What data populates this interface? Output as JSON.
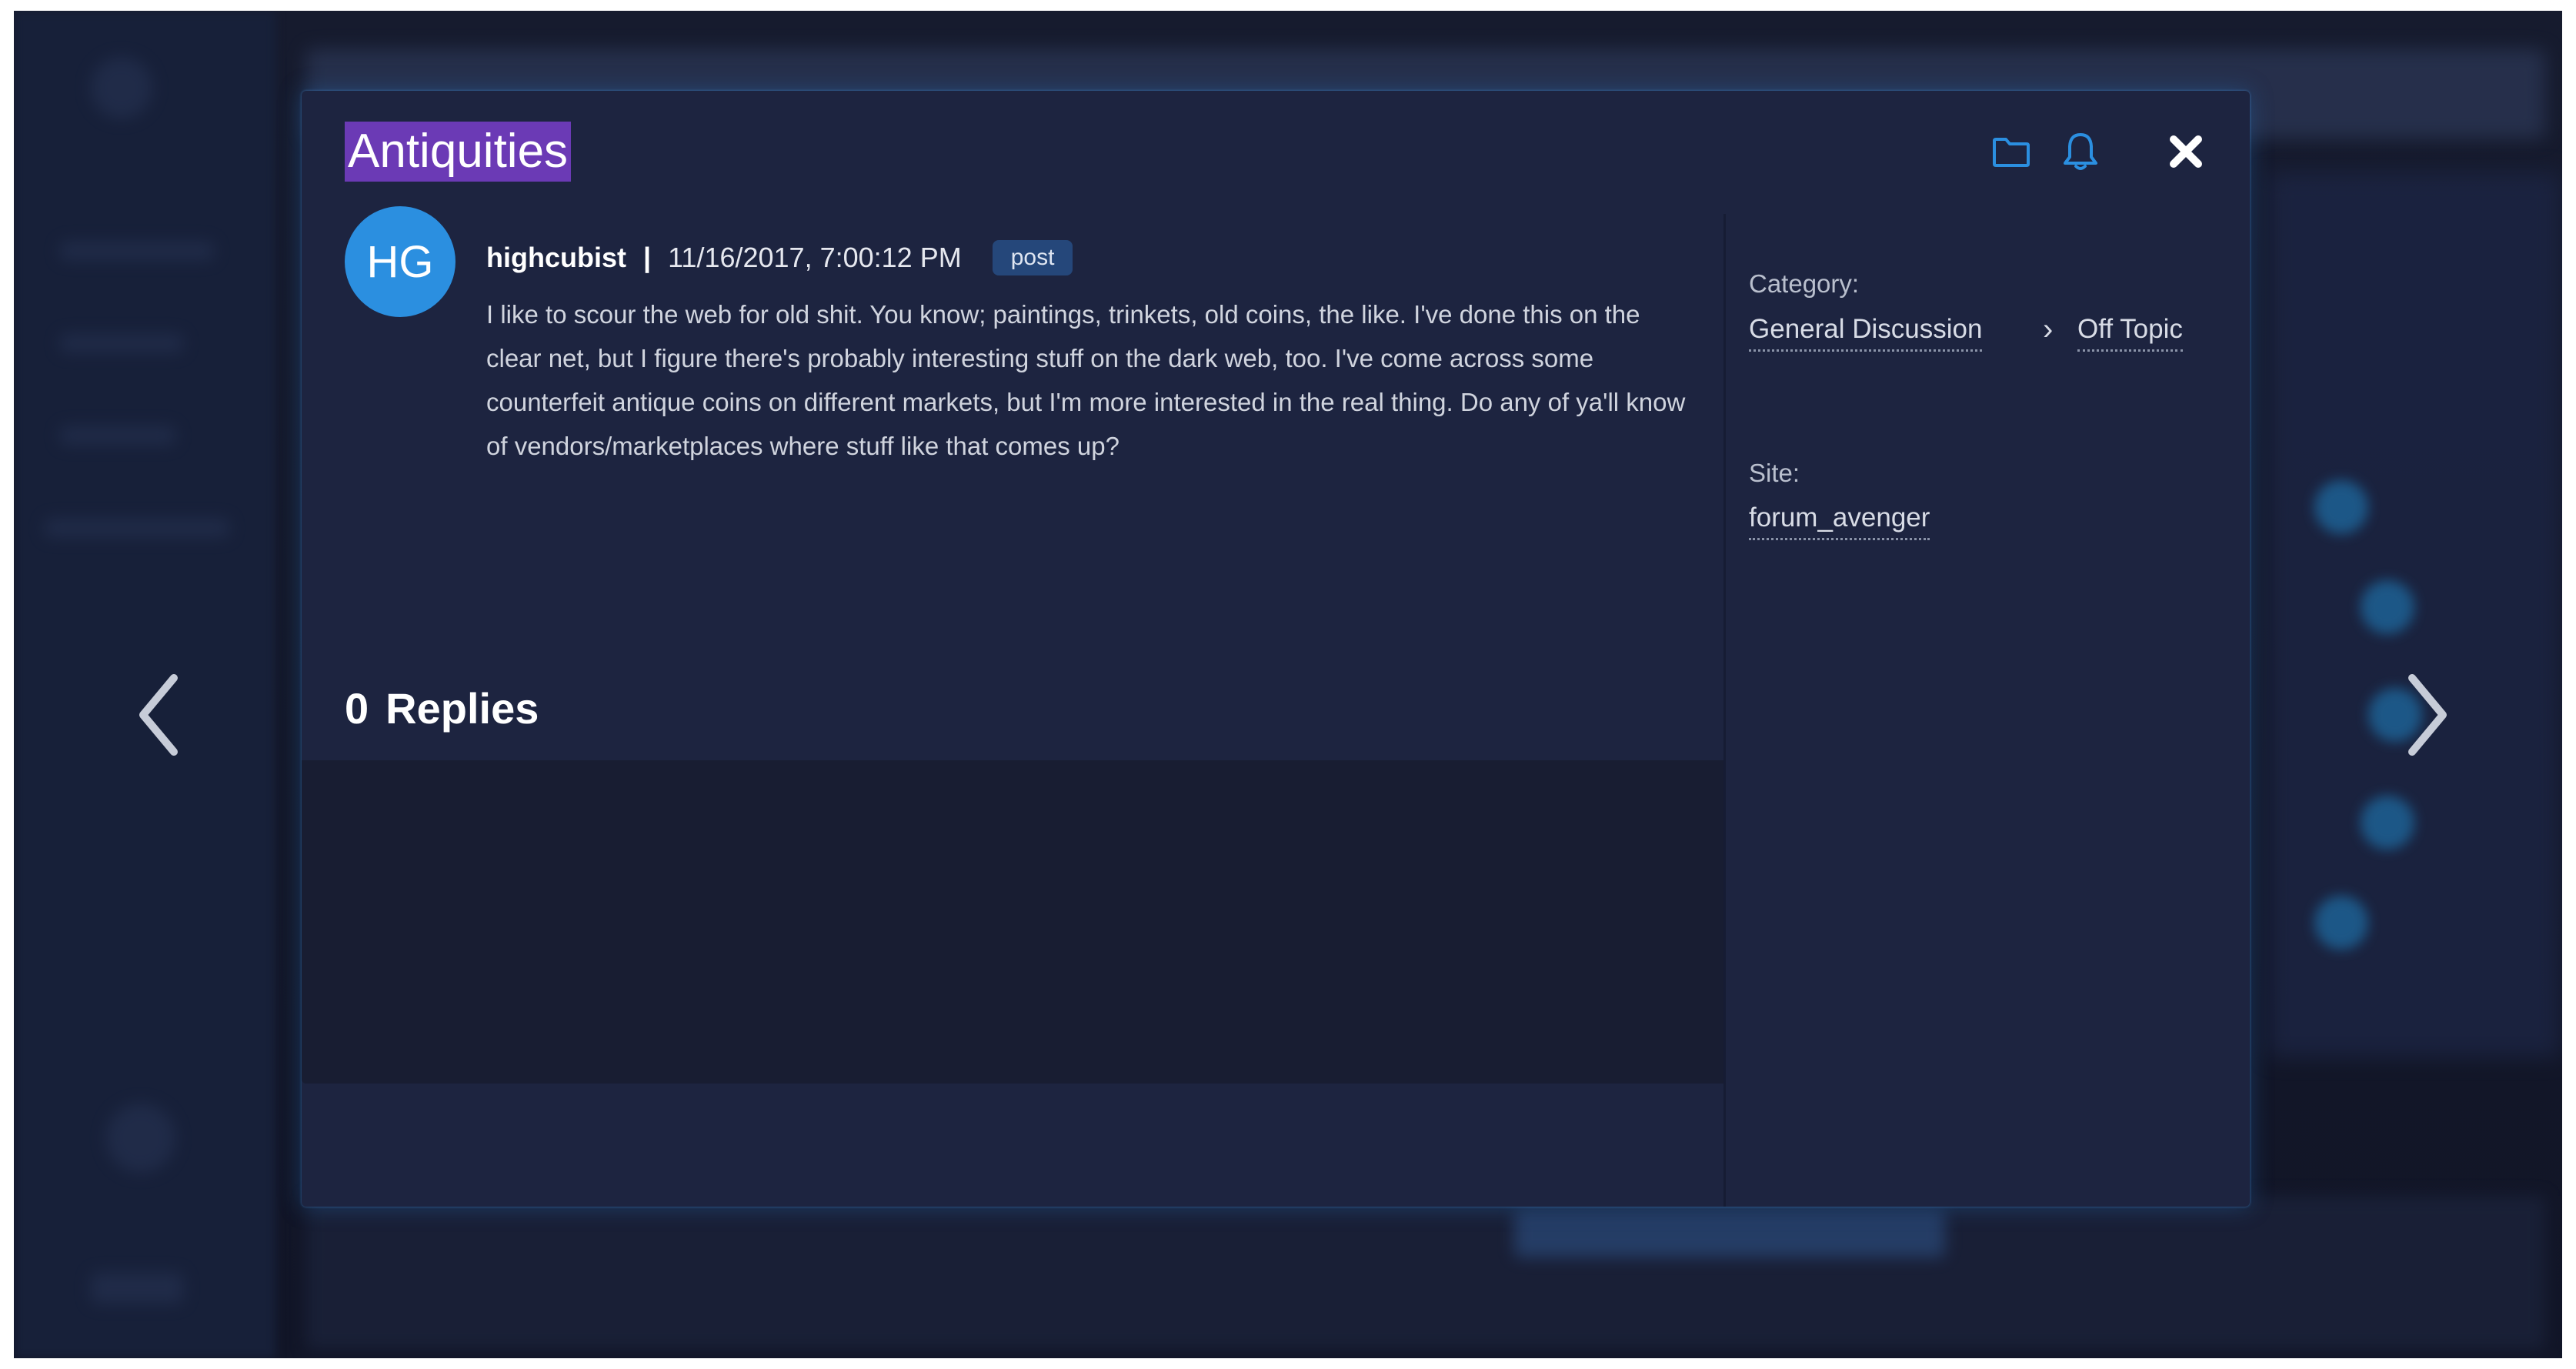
{
  "modal": {
    "title": "Antiquities",
    "close_label": "✖"
  },
  "post": {
    "avatar_initials": "HG",
    "author": "highcubist",
    "separator": "|",
    "timestamp": "11/16/2017, 7:00:12 PM",
    "badge": "post",
    "body": "I like to scour the web for old shit. You know; paintings, trinkets, old coins, the like. I've done this on the clear net, but I figure there's probably interesting stuff on the dark web, too. I've come across some counterfeit antique coins on different markets, but I'm more interested in the real thing. Do any of ya'll know of vendors/marketplaces where stuff like that comes up?"
  },
  "replies": {
    "count": "0",
    "label": "Replies"
  },
  "sidebar": {
    "category_label": "Category:",
    "category": "General Discussion",
    "subcategory_chevron": "›",
    "subcategory": "Off Topic",
    "site_label": "Site:",
    "site": "forum_avenger"
  },
  "icons": {
    "folder": "folder-icon",
    "bell": "bell-icon",
    "close": "close-icon",
    "prev": "chevron-left-icon",
    "next": "chevron-right-icon"
  },
  "colors": {
    "accent": "#2b8fe0",
    "title_highlight": "#6b3ab5",
    "modal_bg": "#1d2440"
  }
}
